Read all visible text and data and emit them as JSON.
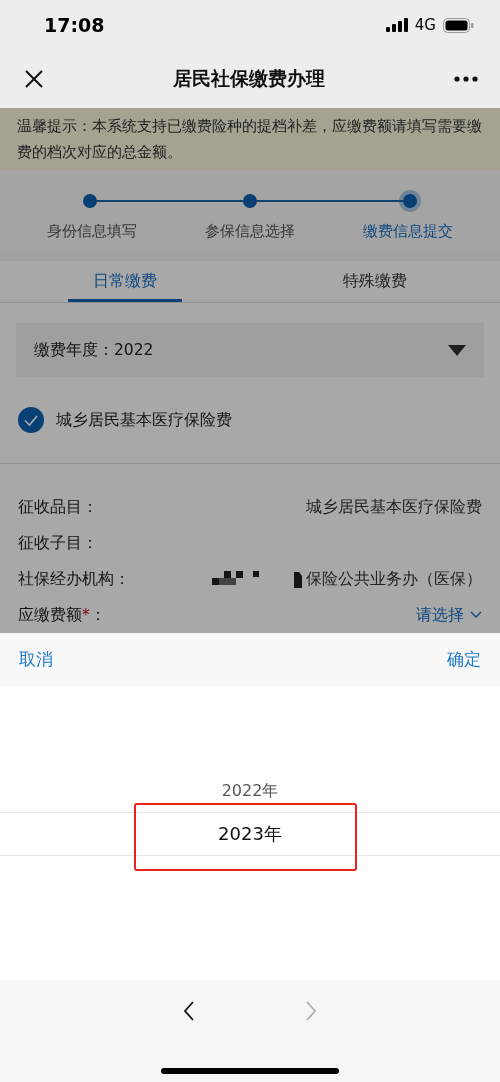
{
  "status_bar": {
    "time": "17:08",
    "network": "4G"
  },
  "nav": {
    "title": "居民社保缴费办理"
  },
  "notice": "温馨提示：本系统支持已缴费险种的提档补差，应缴费额请填写需要缴费的档次对应的总金额。",
  "steps": [
    {
      "label": "身份信息填写",
      "current": false
    },
    {
      "label": "参保信息选择",
      "current": false
    },
    {
      "label": "缴费信息提交",
      "current": true
    }
  ],
  "tabs": [
    {
      "label": "日常缴费",
      "selected": true
    },
    {
      "label": "特殊缴费",
      "selected": false
    }
  ],
  "year_select": {
    "label": "缴费年度：2022"
  },
  "insurance": {
    "label": "城乡居民基本医疗保险费",
    "checked": true
  },
  "fields": [
    {
      "label": "征收品目：",
      "value": "城乡居民基本医疗保险费",
      "kind": "text"
    },
    {
      "label": "征收子目：",
      "kind": "text"
    },
    {
      "label": "社保经办机构：",
      "value": "保险公共业务办（医保）",
      "kind": "masked"
    },
    {
      "label": "应缴费额",
      "required_mark": "*",
      "colon": "：",
      "value": "请选择",
      "kind": "select"
    }
  ],
  "picker": {
    "cancel": "取消",
    "confirm": "确定",
    "highlight_box": true,
    "options": [
      {
        "label": "2022年",
        "selected": false
      },
      {
        "label": "2023年",
        "selected": true
      }
    ]
  },
  "nav_arrows": [
    {
      "kind": "back",
      "disabled": false
    },
    {
      "kind": "forward",
      "disabled": true
    }
  ]
}
